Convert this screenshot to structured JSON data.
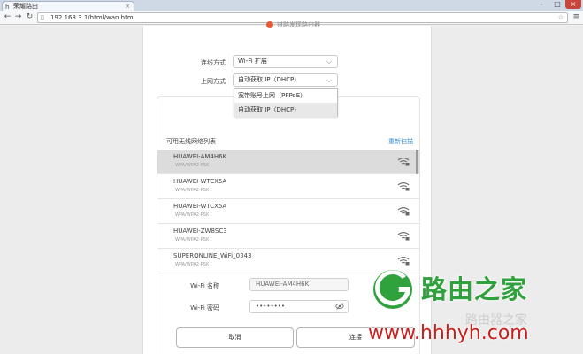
{
  "browser": {
    "tab_title": "荣耀路由",
    "url": "192.168.3.1/html/wan.html",
    "window_controls": [
      "–",
      "□",
      "×"
    ]
  },
  "page": {
    "top_hint": "道路发现路由器",
    "connection_mode_label": "连线方式",
    "connection_mode_value": "Wi-Fi 扩展",
    "internet_mode_label": "上网方式",
    "internet_mode_value": "自动获取 IP（DHCP）",
    "dropdown_options": [
      "宽带账号上网（PPPoE）",
      "自动获取 IP（DHCP）"
    ],
    "list_title": "可用无线网络列表",
    "rescan_label": "重新扫描",
    "networks": [
      {
        "ssid": "HUAWEI-AM4H6K",
        "security": "WPA/WPA2-PSK",
        "active": true
      },
      {
        "ssid": "HUAWEI-WTCX5A",
        "security": "WPA/WPA2-PSK",
        "active": false
      },
      {
        "ssid": "HUAWEI-WTCX5A",
        "security": "WPA/WPA2-PSK",
        "active": false
      },
      {
        "ssid": "HUAWEI-ZW8SC3",
        "security": "WPA/WPA2-PSK",
        "active": false
      },
      {
        "ssid": "SUPERONLINE_WiFi_0343",
        "security": "WPA/WPA2-PSK",
        "active": false
      }
    ],
    "wifi_name_label": "Wi-Fi 名称",
    "wifi_name_value": "HUAWEI-AM4H6K",
    "wifi_password_label": "Wi-Fi 密码",
    "wifi_password_value": "••••••••",
    "cancel_label": "取消",
    "connect_label": "连接"
  },
  "watermark": {
    "name": "路由之家",
    "url": "www.hhhyh.com",
    "ghost_text": "路由器之家"
  },
  "colors": {
    "accent_link": "#3b8fd6",
    "watermark_green": "#2fa23d",
    "watermark_red": "#c8201e"
  }
}
